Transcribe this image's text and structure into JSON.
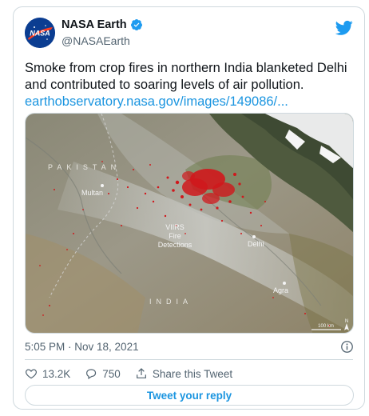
{
  "author": {
    "display_name": "NASA Earth",
    "handle": "@NASAEarth",
    "avatar_icon": "nasa-meatball-logo"
  },
  "tweet": {
    "text": "Smoke from crop fires in northern India blanketed Delhi and contributed to soaring levels of air pollution.",
    "link": "earthobservatory.nasa.gov/images/149086/...",
    "timestamp": "5:05 PM · Nov 18, 2021"
  },
  "media": {
    "labels": {
      "pakistan": "PAKISTAN",
      "india": "INDIA",
      "multan": "Multan",
      "delhi": "Delhi",
      "agra": "Agra",
      "viirs_line1": "VIIRS",
      "viirs_line2": "Fire",
      "viirs_line3": "Detections",
      "scale": "100 km",
      "north": "N"
    }
  },
  "actions": {
    "likes": "13.2K",
    "retweets": "750",
    "share_label": "Share this Tweet",
    "reply_button_label": "Tweet your reply"
  },
  "colors": {
    "accent": "#1b95e0",
    "verified": "#1d9bf0",
    "muted": "#536471",
    "fire": "#d0181c"
  }
}
